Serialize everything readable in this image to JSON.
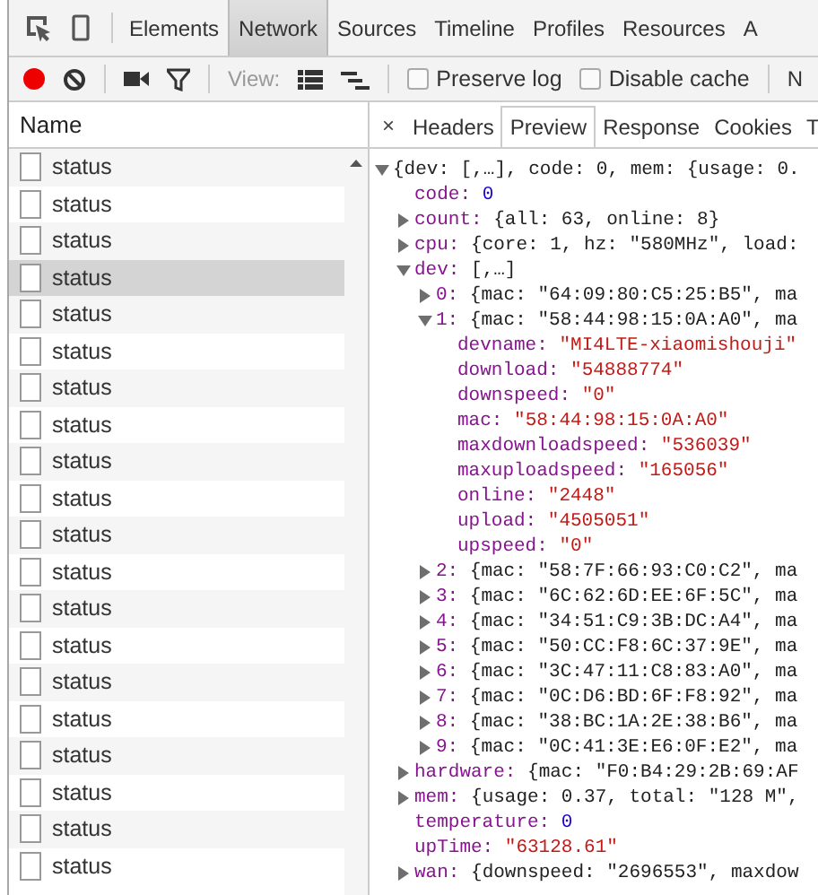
{
  "main_tabs": [
    {
      "label": "Elements",
      "selected": false
    },
    {
      "label": "Network",
      "selected": true
    },
    {
      "label": "Sources",
      "selected": false
    },
    {
      "label": "Timeline",
      "selected": false
    },
    {
      "label": "Profiles",
      "selected": false
    },
    {
      "label": "Resources",
      "selected": false
    },
    {
      "label": "A",
      "selected": false
    }
  ],
  "toolbar": {
    "recording": true,
    "view_label": "View:",
    "checkboxes": [
      {
        "label": "Preserve log",
        "checked": false
      },
      {
        "label": "Disable cache",
        "checked": false
      }
    ],
    "overflow_label": "N"
  },
  "requests": {
    "column": "Name",
    "rows": [
      {
        "name": "status",
        "selected": false
      },
      {
        "name": "status",
        "selected": false
      },
      {
        "name": "status",
        "selected": false
      },
      {
        "name": "status",
        "selected": true
      },
      {
        "name": "status",
        "selected": false
      },
      {
        "name": "status",
        "selected": false
      },
      {
        "name": "status",
        "selected": false
      },
      {
        "name": "status",
        "selected": false
      },
      {
        "name": "status",
        "selected": false
      },
      {
        "name": "status",
        "selected": false
      },
      {
        "name": "status",
        "selected": false
      },
      {
        "name": "status",
        "selected": false
      },
      {
        "name": "status",
        "selected": false
      },
      {
        "name": "status",
        "selected": false
      },
      {
        "name": "status",
        "selected": false
      },
      {
        "name": "status",
        "selected": false
      },
      {
        "name": "status",
        "selected": false
      },
      {
        "name": "status",
        "selected": false
      },
      {
        "name": "status",
        "selected": false
      },
      {
        "name": "status",
        "selected": false
      }
    ]
  },
  "detail_tabs": {
    "close": "×",
    "tabs": [
      {
        "label": "Headers",
        "selected": false
      },
      {
        "label": "Preview",
        "selected": true
      },
      {
        "label": "Response",
        "selected": false
      },
      {
        "label": "Cookies",
        "selected": false
      },
      {
        "label": "T",
        "selected": false
      }
    ]
  },
  "preview": {
    "summary": "{dev: [,…], code: 0, mem: {usage: 0.",
    "expanded": true,
    "children": [
      {
        "key": "code:",
        "value": "0",
        "kind": "number"
      },
      {
        "key": "count:",
        "value": "{all: 63, online: 8}",
        "kind": "object",
        "expanded": false
      },
      {
        "key": "cpu:",
        "value": "{core: 1, hz: \"580MHz\", load:",
        "kind": "object",
        "expanded": false
      },
      {
        "key": "dev:",
        "value": "[,…]",
        "kind": "object",
        "expanded": true,
        "children": [
          {
            "key": "0:",
            "value": "{mac: \"64:09:80:C5:25:B5\", ma",
            "kind": "object",
            "expanded": false
          },
          {
            "key": "1:",
            "value": "{mac: \"58:44:98:15:0A:A0\", ma",
            "kind": "object",
            "expanded": true,
            "children": [
              {
                "key": "devname:",
                "value": "\"MI4LTE-xiaomishouji\"",
                "kind": "string"
              },
              {
                "key": "download:",
                "value": "\"54888774\"",
                "kind": "string"
              },
              {
                "key": "downspeed:",
                "value": "\"0\"",
                "kind": "string"
              },
              {
                "key": "mac:",
                "value": "\"58:44:98:15:0A:A0\"",
                "kind": "string"
              },
              {
                "key": "maxdownloadspeed:",
                "value": "\"536039\"",
                "kind": "string"
              },
              {
                "key": "maxuploadspeed:",
                "value": "\"165056\"",
                "kind": "string"
              },
              {
                "key": "online:",
                "value": "\"2448\"",
                "kind": "string"
              },
              {
                "key": "upload:",
                "value": "\"4505051\"",
                "kind": "string"
              },
              {
                "key": "upspeed:",
                "value": "\"0\"",
                "kind": "string"
              }
            ]
          },
          {
            "key": "2:",
            "value": "{mac: \"58:7F:66:93:C0:C2\", ma",
            "kind": "object",
            "expanded": false
          },
          {
            "key": "3:",
            "value": "{mac: \"6C:62:6D:EE:6F:5C\", ma",
            "kind": "object",
            "expanded": false
          },
          {
            "key": "4:",
            "value": "{mac: \"34:51:C9:3B:DC:A4\", ma",
            "kind": "object",
            "expanded": false
          },
          {
            "key": "5:",
            "value": "{mac: \"50:CC:F8:6C:37:9E\", ma",
            "kind": "object",
            "expanded": false
          },
          {
            "key": "6:",
            "value": "{mac: \"3C:47:11:C8:83:A0\", ma",
            "kind": "object",
            "expanded": false
          },
          {
            "key": "7:",
            "value": "{mac: \"0C:D6:BD:6F:F8:92\", ma",
            "kind": "object",
            "expanded": false
          },
          {
            "key": "8:",
            "value": "{mac: \"38:BC:1A:2E:38:B6\", ma",
            "kind": "object",
            "expanded": false
          },
          {
            "key": "9:",
            "value": "{mac: \"0C:41:3E:E6:0F:E2\", ma",
            "kind": "object",
            "expanded": false
          }
        ]
      },
      {
        "key": "hardware:",
        "value": "{mac: \"F0:B4:29:2B:69:AF",
        "kind": "object",
        "expanded": false
      },
      {
        "key": "mem:",
        "value": "{usage: 0.37, total: \"128 M\",",
        "kind": "object",
        "expanded": false
      },
      {
        "key": "temperature:",
        "value": "0",
        "kind": "number"
      },
      {
        "key": "upTime:",
        "value": "\"63128.61\"",
        "kind": "string"
      },
      {
        "key": "wan:",
        "value": "{downspeed: \"2696553\", maxdow",
        "kind": "object",
        "expanded": false
      }
    ]
  }
}
